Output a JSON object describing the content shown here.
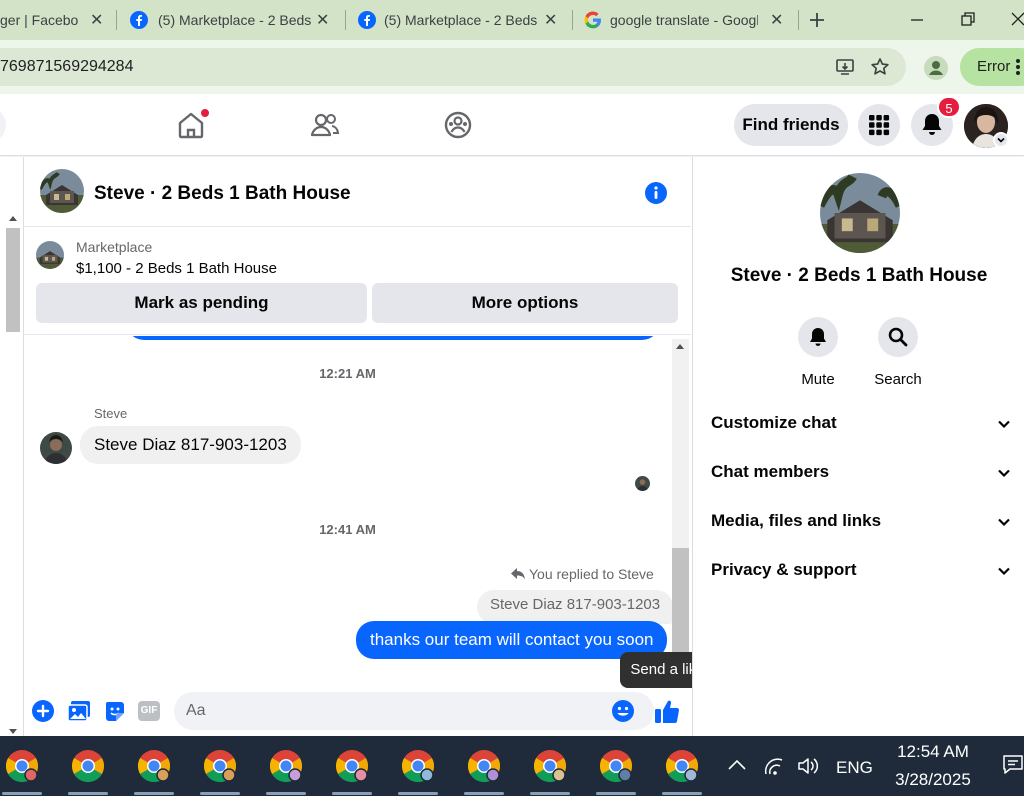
{
  "browser": {
    "tabs": [
      {
        "title": "ger | Facebook",
        "active": false
      },
      {
        "title": "(5) Marketplace - 2 Beds",
        "active": false
      },
      {
        "title": "(5) Marketplace - 2 Beds",
        "active": false
      },
      {
        "title": "google translate - Google",
        "active": false
      }
    ],
    "url": "769871569294284",
    "error_label": "Error"
  },
  "fb_nav": {
    "find_friends": "Find friends",
    "notification_count": "5"
  },
  "chat": {
    "title": "Steve · 2 Beds 1 Bath House",
    "listing": {
      "label": "Marketplace",
      "price_title": "$1,100 - 2 Beds 1 Bath House",
      "mark_pending": "Mark as pending",
      "more_options": "More options"
    },
    "messages": {
      "time1": "12:21 AM",
      "sender_name": "Steve",
      "incoming_text": "Steve Diaz 817-903-1203",
      "time2": "12:41 AM",
      "reply_note": "You replied to Steve",
      "quoted_text": "Steve Diaz 817-903-1203",
      "outgoing_text": "thanks our team will contact you soon"
    },
    "composer": {
      "placeholder": "Aa",
      "gif_label": "GIF",
      "tooltip": "Send a like"
    }
  },
  "info_panel": {
    "title": "Steve · 2 Beds 1 Bath House",
    "mute_label": "Mute",
    "search_label": "Search",
    "sections": [
      {
        "label": "Customize chat"
      },
      {
        "label": "Chat members"
      },
      {
        "label": "Media, files and links"
      },
      {
        "label": "Privacy & support"
      }
    ]
  },
  "taskbar": {
    "language": "ENG",
    "time": "12:54 AM",
    "date": "3/28/2025"
  },
  "colors": {
    "messenger_blue": "#0866ff",
    "notification_red": "#e41e3f",
    "chrome_tabstrip": "#d3e3c8",
    "taskbar": "#1f2b3a"
  }
}
